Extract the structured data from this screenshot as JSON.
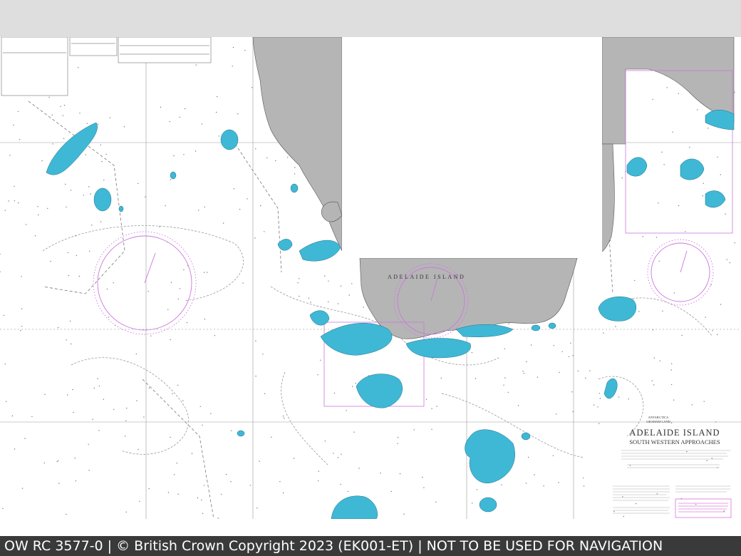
{
  "footer": {
    "text": "OW RC 3577-0 | © British Crown Copyright 2023 (EK001-ET) | NOT TO BE USED FOR NAVIGATION"
  },
  "chart_labels": {
    "island_name": "ADELAIDE  ISLAND",
    "region_small_1": "ANTARCTICA",
    "region_small_2": "GRAHAM LAND",
    "title": "ADELAIDE ISLAND",
    "subtitle": "SOUTH WESTERN APPROACHES"
  },
  "colors": {
    "land": "#b5b5b5",
    "shoal": "#3fb8d6",
    "compass": "#cc77dd",
    "ink": "#333333",
    "frame_band": "#dedede",
    "footer_bg": "#3a3a3a"
  }
}
